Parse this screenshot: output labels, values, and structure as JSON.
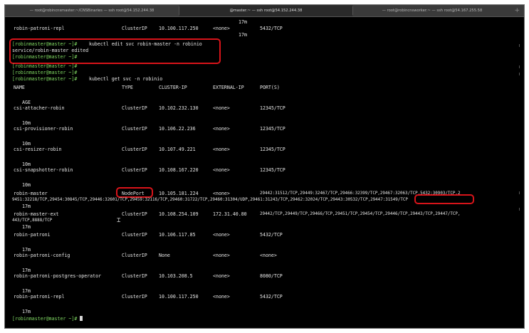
{
  "tabs": [
    "— root@robincnsmaster:~/CNSBinaries — ssh root@54.152.244.38",
    "@master:~ — ssh root@54.152.244.38",
    "— root@robincnsworker:~ — ssh root@54.167.255.58"
  ],
  "new_tab": "+",
  "prev": {
    "age_1": "17m",
    "row_name": "robin-patroni-repl",
    "row_type": "ClusterIP",
    "row_ip": "10.100.117.250",
    "row_ext": "<none>",
    "row_age": "17m",
    "row_ports": "5432/TCP"
  },
  "prompt": "[robinmaster@master ~]#",
  "cmd_edit_a": " kubectl edit svc robin-master -n robinio",
  "cmd_edit_b": "service/robin-master edited",
  "cmd_get": " kubectl get svc -n robinio",
  "headers": {
    "name": "NAME",
    "type": "TYPE",
    "ip": "CLUSTER-IP",
    "ext": "EXTERNAL-IP",
    "ports": "PORT(S)",
    "age": "AGE"
  },
  "rows": [
    {
      "name": "csi-attacher-robin",
      "type": "ClusterIP",
      "ip": "10.102.232.130",
      "ext": "<none>",
      "ports": "12345/TCP",
      "age": "10m"
    },
    {
      "name": "csi-provisioner-robin",
      "type": "ClusterIP",
      "ip": "10.106.22.236",
      "ext": "<none>",
      "ports": "12345/TCP",
      "age": "10m"
    },
    {
      "name": "csi-resizer-robin",
      "type": "ClusterIP",
      "ip": "10.107.49.221",
      "ext": "<none>",
      "ports": "12345/TCP",
      "age": "10m"
    },
    {
      "name": "csi-snapshotter-robin",
      "type": "ClusterIP",
      "ip": "10.108.167.220",
      "ext": "<none>",
      "ports": "12345/TCP",
      "age": "10m"
    }
  ],
  "robin_master": {
    "name": "robin-master",
    "type": "NodePort",
    "ip": "10.105.181.224",
    "ext": "<none>",
    "ports_1": "29442:31512/TCP,29449:32467/TCP,29466:32399/TCP,29467:32063/TCP,5432:30903/TCP,2",
    "ports_2a": "9451:32218/TCP,29454:30845/TCP,29446:32601/TCP,29459:32116/TCP,29460:31722/TCP,29460:31304/UDP,29461:31243/TCP,29462:32024/TCP,",
    "ports_2b": "29443:30532/TCP",
    "ports_2c": ",29447:31549/TCP",
    "age": "17m"
  },
  "robin_master_ext": {
    "name": "robin-master-ext",
    "type": "ClusterIP",
    "ip": "10.108.254.109",
    "ext": "172.31.40.80",
    "ports_1": "29442/TCP,29449/TCP,29466/TCP,29451/TCP,29454/TCP,29446/TCP,29443/TCP,29447/TCP,",
    "ports_2": "443/TCP,8888/TCP",
    "age": "17m"
  },
  "rows2": [
    {
      "name": "robin-patroni",
      "type": "ClusterIP",
      "ip": "10.106.117.85",
      "ext": "<none>",
      "ports": "5432/TCP",
      "age": "17m"
    },
    {
      "name": "robin-patroni-config",
      "type": "ClusterIP",
      "ip": "None",
      "ext": "<none>",
      "ports": "<none>",
      "age": "17m"
    },
    {
      "name": "robin-patroni-postgres-operator",
      "type": "ClusterIP",
      "ip": "10.103.208.5",
      "ext": "<none>",
      "ports": "8080/TCP",
      "age": "17m"
    },
    {
      "name": "robin-patroni-repl",
      "type": "ClusterIP",
      "ip": "10.100.117.250",
      "ext": "<none>",
      "ports": "5432/TCP",
      "age": "17m"
    }
  ],
  "highlight_color": "#d8141a",
  "prompt_color": "#7fd862"
}
